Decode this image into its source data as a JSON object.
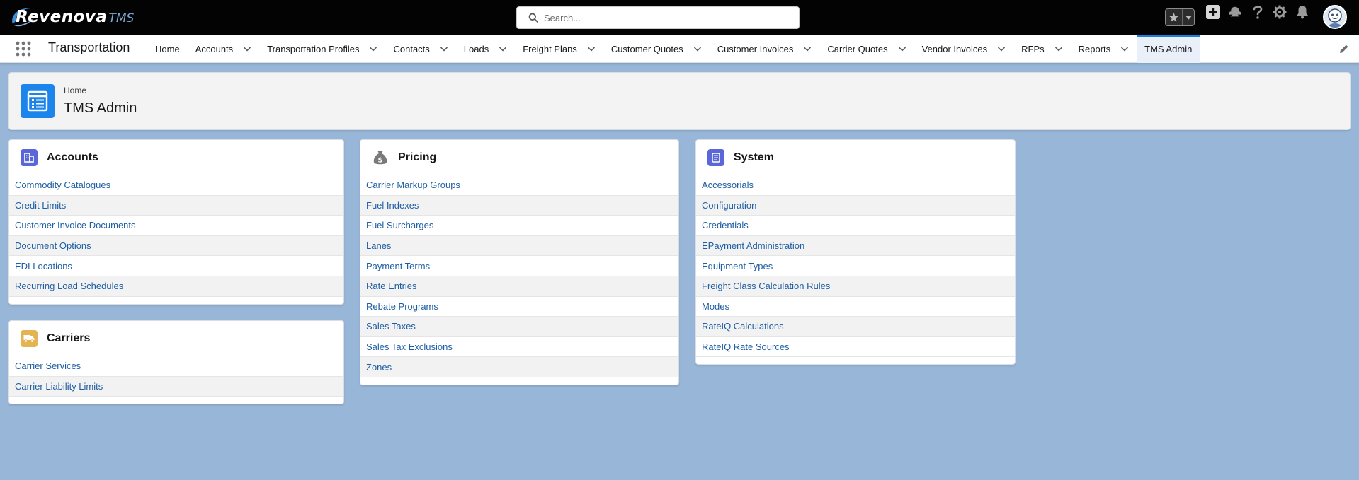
{
  "global_header": {
    "brand_name": "Revenova",
    "brand_suffix": "TMS",
    "search_placeholder": "Search...",
    "icons": [
      "favorites-star-icon",
      "favorites-dropdown-icon",
      "global-create-icon",
      "trailhead-help-icon",
      "help-icon",
      "setup-gear-icon",
      "notifications-bell-icon",
      "user-avatar"
    ]
  },
  "nav": {
    "app_name": "Transportation",
    "items": [
      {
        "label": "Home",
        "has_menu": false
      },
      {
        "label": "Accounts",
        "has_menu": true
      },
      {
        "label": "Transportation Profiles",
        "has_menu": true
      },
      {
        "label": "Contacts",
        "has_menu": true
      },
      {
        "label": "Loads",
        "has_menu": true
      },
      {
        "label": "Freight Plans",
        "has_menu": true
      },
      {
        "label": "Customer Quotes",
        "has_menu": true
      },
      {
        "label": "Customer Invoices",
        "has_menu": true
      },
      {
        "label": "Carrier Quotes",
        "has_menu": true
      },
      {
        "label": "Vendor Invoices",
        "has_menu": true
      },
      {
        "label": "RFPs",
        "has_menu": true
      },
      {
        "label": "Reports",
        "has_menu": true
      },
      {
        "label": "TMS Admin",
        "has_menu": false,
        "active": true
      }
    ]
  },
  "page_header": {
    "breadcrumb": "Home",
    "title": "TMS Admin",
    "icon": "list-icon",
    "icon_color": "#1c85eb"
  },
  "cards": {
    "accounts": {
      "title": "Accounts",
      "icon": "building-icon",
      "icon_color": "#5a67d8",
      "links": [
        "Commodity Catalogues",
        "Credit Limits",
        "Customer Invoice Documents",
        "Document Options",
        "EDI Locations",
        "Recurring Load Schedules"
      ]
    },
    "carriers": {
      "title": "Carriers",
      "icon": "truck-icon",
      "icon_color": "#e4b452",
      "links": [
        "Carrier Services",
        "Carrier Liability Limits"
      ]
    },
    "pricing": {
      "title": "Pricing",
      "icon": "money-bag-icon",
      "icon_color": "#7a7a7a",
      "links": [
        "Carrier Markup Groups",
        "Fuel Indexes",
        "Fuel Surcharges",
        "Lanes",
        "Payment Terms",
        "Rate Entries",
        "Rebate Programs",
        "Sales Taxes",
        "Sales Tax Exclusions",
        "Zones"
      ]
    },
    "system": {
      "title": "System",
      "icon": "checklist-icon",
      "icon_color": "#5a67d8",
      "links": [
        "Accessorials",
        "Configuration",
        "Credentials",
        "EPayment Administration",
        "Equipment Types",
        "Freight Class Calculation Rules",
        "Modes",
        "RateIQ Calculations",
        "RateIQ Rate Sources"
      ]
    }
  },
  "colors": {
    "background": "#97b6d8",
    "link": "#1e5ea4",
    "header_bg": "#030303",
    "nav_active_accent": "#1b7fe0"
  }
}
